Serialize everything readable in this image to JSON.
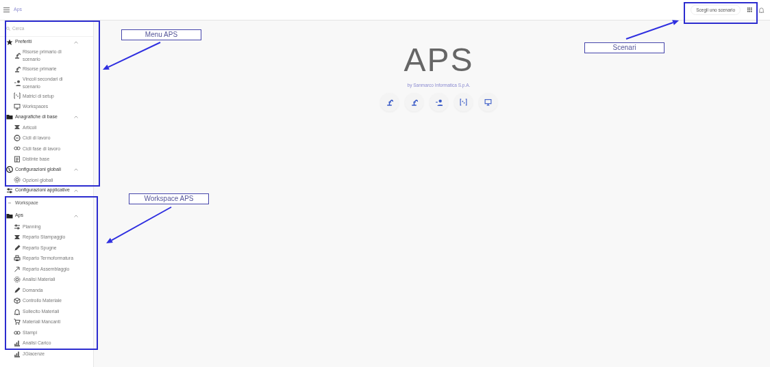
{
  "header": {
    "title": "Aps",
    "scenario_button": "Scegli uno scenario"
  },
  "sidebar": {
    "search": {
      "placeholder": "Cerca"
    },
    "sections": [
      {
        "label": "Preferiti",
        "expanded": true,
        "items": [
          "Risorse primario di\nscenario",
          "Risorse primarie",
          "Vincoli secondari di\nscenario",
          "Matrici di setup",
          "Workspaces"
        ]
      },
      {
        "label": "Anagrafiche di base",
        "expanded": true,
        "items": [
          "Articoli",
          "Cicli di lavoro",
          "Cicli fase di lavoro",
          "Distinte base"
        ]
      },
      {
        "label": "Configurazioni globali",
        "expanded": true,
        "items": [
          "Opzioni globali"
        ]
      },
      {
        "label": "Configurazioni applicative",
        "expanded": true
      }
    ],
    "workspace": {
      "label": "Workspace",
      "expanded": true,
      "groups": [
        {
          "label": "Aps",
          "expanded": true,
          "items": [
            "Planning",
            "Reparto Stampaggio",
            "Reparto Spugne",
            "Reparto Termoformatura",
            "Reparto Assemblaggio",
            "Analisi Materiali",
            "Domanda",
            "Controllo Materiale",
            "Sollecito Materiali",
            "Materiali Mancanti",
            "Stampi",
            "Analisi Carico",
            "JGiacenze"
          ]
        }
      ]
    }
  },
  "main": {
    "title": "APS",
    "subtitle": "by Sanmarco Informatica S.p.A."
  },
  "annotations": [
    {
      "label": "Menu APS"
    },
    {
      "label": "Workspace APS"
    },
    {
      "label": "Scenari"
    }
  ]
}
